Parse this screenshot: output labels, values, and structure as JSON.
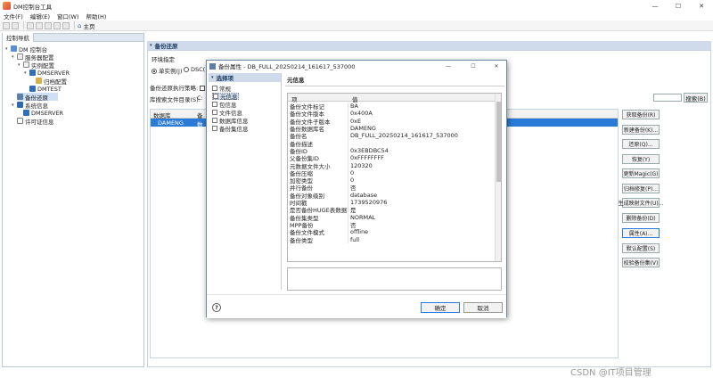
{
  "app": {
    "title": "DM控制台工具"
  },
  "menu": [
    "文件(F)",
    "编辑(E)",
    "窗口(W)",
    "帮助(H)"
  ],
  "toolbar": {
    "home_label": "主页"
  },
  "nav": {
    "tab_label": "控制导航",
    "tree": [
      {
        "label": "DM 控制台",
        "level": 0,
        "icon": "console-icon"
      },
      {
        "label": "服务器配置",
        "level": 1,
        "icon": "gear-icon"
      },
      {
        "label": "实例配置",
        "level": 2,
        "icon": "gear-icon"
      },
      {
        "label": "DMSERVER",
        "level": 3,
        "icon": "database-icon"
      },
      {
        "label": "归档配置",
        "level": 4,
        "icon": "folder-icon"
      },
      {
        "label": "DMTEST",
        "level": 3,
        "icon": "database-icon"
      },
      {
        "label": "备份还原",
        "level": 1,
        "icon": "backup-icon",
        "selected": true
      },
      {
        "label": "系统信息",
        "level": 1,
        "icon": "info-icon"
      },
      {
        "label": "DMSERVER",
        "level": 2,
        "icon": "database-icon"
      },
      {
        "label": "许可证信息",
        "level": 1,
        "icon": "license-icon"
      }
    ]
  },
  "main": {
    "header": "备份还原",
    "env_label": "环境指定",
    "radio_single": "单实例(J)",
    "radio_dsc": "DSC(",
    "running_label": "备份还原执行策略:",
    "search_dir_label": "库搜索文件目录(S):",
    "search_dir_prefix": "C:",
    "browse_button": "搜索(B)",
    "table_headers": [
      "数据库",
      "备"
    ],
    "table_row": [
      "DAMENG",
      "数"
    ]
  },
  "right_buttons": [
    "获取备份(R)",
    "新建备份(K)...",
    "还原(Q)...",
    "恢复(Y)",
    "更新Magic(G)",
    "归档修复(P)...",
    "生成映射文件(U)...",
    "删除备份(D)",
    "属性(A)...",
    "默认配置(S)",
    "校验备份集(V)"
  ],
  "dialog": {
    "title": "备份属性 - DB_FULL_20250214_161617_537000",
    "nav_header": "选择项",
    "nav_items": [
      "常规",
      "元信息",
      "包信息",
      "文件信息",
      "数据库信息",
      "备份集信息"
    ],
    "selected_index": 1,
    "section_title": "元信息",
    "col_key": "项",
    "col_value": "值",
    "rows": [
      [
        "备份文件标记",
        "BA"
      ],
      [
        "备份文件版本",
        "0x400A"
      ],
      [
        "备份文件子版本",
        "0xE"
      ],
      [
        "备份数据库名",
        "DAMENG"
      ],
      [
        "备份名",
        "DB_FULL_20250214_161617_537000"
      ],
      [
        "备份描述",
        ""
      ],
      [
        "备份ID",
        "0x3EBDBC54"
      ],
      [
        "父备份集ID",
        "0xFFFFFFFF"
      ],
      [
        "元数据文件大小",
        "120320"
      ],
      [
        "备份压缩",
        "0"
      ],
      [
        "加密类型",
        "0"
      ],
      [
        "并行备份",
        "否"
      ],
      [
        "备份对象级别",
        "database"
      ],
      [
        "时间戳",
        "1739520976"
      ],
      [
        "是否备份HUGE表数据",
        "是"
      ],
      [
        "备份集类型",
        "NORMAL"
      ],
      [
        "MPP备份",
        "否"
      ],
      [
        "备份文件模式",
        "offline"
      ],
      [
        "备份类型",
        "full"
      ]
    ],
    "ok_button": "确定",
    "cancel_button": "取消"
  },
  "watermark": "CSDN @IT项目管理"
}
